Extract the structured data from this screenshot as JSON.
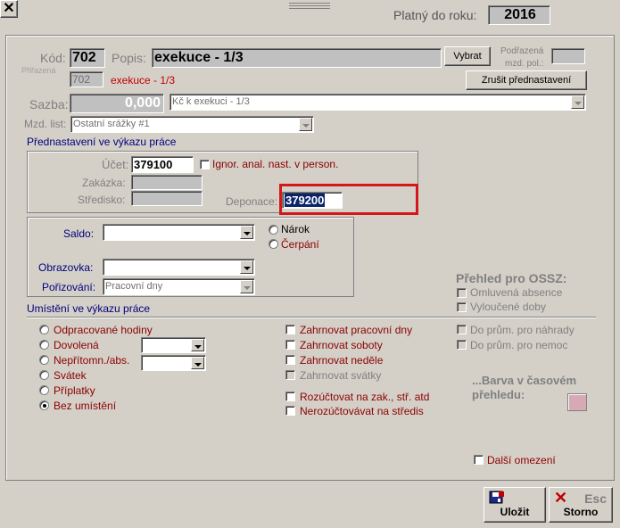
{
  "window": {
    "close_glyph": "✕"
  },
  "header": {
    "platny_label": "Platný do roku:",
    "year": "2016"
  },
  "top": {
    "kod_label": "Kód:",
    "kod_value": "702",
    "prirazena_label": "Přiřazená",
    "kod_sub_value": "702",
    "popis_label": "Popis:",
    "popis_value": "exekuce - 1/3",
    "popis_sub": "exekuce - 1/3",
    "vybrat_label": "Vybrat",
    "podrazena_label1": "Podřazená",
    "podrazena_label2": "mzd. pol.:",
    "zrusit_label": "Zrušit přednastavení",
    "sazba_label": "Sazba:",
    "sazba_value": "0,000",
    "sazba_combo": "Kč k exekuci - 1/3",
    "mzd_list_label": "Mzd. list:",
    "mzd_list_value": "Ostatní srážky #1"
  },
  "prednastaveni": {
    "title": "Přednastavení ve výkazu práce",
    "ucet_label": "Účet:",
    "ucet_value": "379100",
    "ignor_label": "Ignor. anal. nast. v person.",
    "zakazka_label": "Zakázka:",
    "stredisko_label": "Středisko:",
    "deponace_label": "Deponace:",
    "deponace_value": "379200"
  },
  "saldo": {
    "saldo_label": "Saldo:",
    "narok_label": "Nárok",
    "cerpani_label": "Čerpání",
    "obrazovka_label": "Obrazovka:",
    "porizovani_label": "Pořizování:",
    "porizovani_value": "Pracovní dny"
  },
  "ossz": {
    "title": "Přehled pro OSSZ:",
    "omluvena": "Omluvená absence",
    "vyloucene": "Vyloučené doby"
  },
  "umisteni": {
    "title": "Umístění ve výkazu práce",
    "options": [
      "Odpracované hodiny",
      "Dovolená",
      "Nepřítomn./abs.",
      "Svátek",
      "Příplatky",
      "Bez umístění"
    ],
    "selected": "Bez umístění"
  },
  "zahrnovat": {
    "pracovni": "Zahrnovat pracovní dny",
    "soboty": "Zahrnovat soboty",
    "nedele": "Zahrnovat neděle",
    "svatky": "Zahrnovat svátky",
    "rozuctovat": "Rozúčtovat na zak., stř. atd",
    "nerozuctovavat": "Nerozúčtovávat na středis"
  },
  "prum": {
    "nahrady": "Do prům. pro náhrady",
    "nemoc": "Do prům. pro nemoc"
  },
  "barva": {
    "label1": "...Barva v časovém",
    "label2": "přehledu:",
    "color": "#d7a9b4"
  },
  "dalsi_omezeni": "Další omezení",
  "footer": {
    "ulozit_label": "Uložit",
    "storno_label": "Storno",
    "esc_label": "Esc"
  },
  "colors": {
    "highlight_red": "#d3171b",
    "selection": "#0a246a"
  }
}
